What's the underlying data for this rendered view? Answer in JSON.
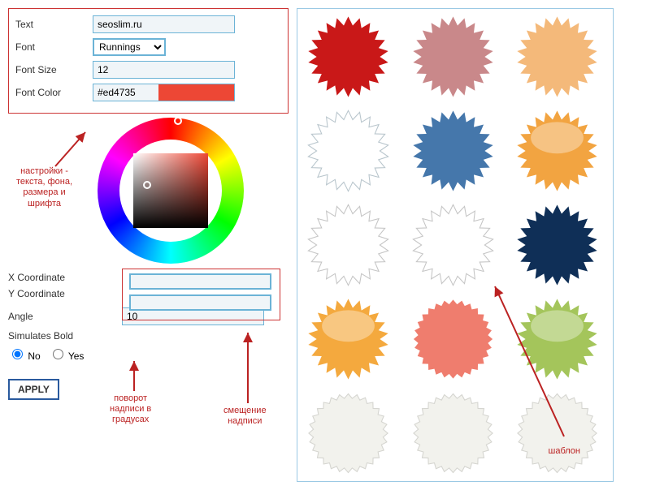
{
  "form": {
    "text_label": "Text",
    "text_value": "seoslim.ru",
    "font_label": "Font",
    "font_value": "Runnings",
    "fontsize_label": "Font Size",
    "fontsize_value": "12",
    "fontcolor_label": "Font Color",
    "fontcolor_value": "#ed4735",
    "xcoord_label": "X Coordinate",
    "xcoord_value": "",
    "ycoord_label": "Y Coordinate",
    "ycoord_value": "",
    "angle_label": "Angle",
    "angle_value": "10",
    "bold_label": "Simulates Bold",
    "radio_no": "No",
    "radio_yes": "Yes",
    "apply": "APPLY"
  },
  "annotations": {
    "settings": "настройки -\nтекста, фона,\nразмера и\nшрифта",
    "rotation": "поворот\nнадписи в\nградусах",
    "offset": "смещение\nнадписи",
    "template": "шаблон"
  },
  "badges": [
    {
      "fill": "#c91818",
      "stroke": "none",
      "type": "spike"
    },
    {
      "fill": "#c9888a",
      "stroke": "none",
      "type": "spike"
    },
    {
      "fill": "#f4b97a",
      "stroke": "none",
      "type": "spike"
    },
    {
      "fill": "#ffffff",
      "stroke": "#b8c5cc",
      "type": "spike"
    },
    {
      "fill": "#4577ab",
      "stroke": "none",
      "type": "spike"
    },
    {
      "fill": "#f2a441",
      "stroke": "none",
      "type": "spike-glossy"
    },
    {
      "fill": "#ffffff",
      "stroke": "#c5c5c5",
      "type": "spike"
    },
    {
      "fill": "#ffffff",
      "stroke": "#c5c5c5",
      "type": "spike"
    },
    {
      "fill": "#0f2f57",
      "stroke": "none",
      "type": "spike"
    },
    {
      "fill": "#f4a93e",
      "stroke": "none",
      "type": "spike-glossy"
    },
    {
      "fill": "#ef7d6e",
      "stroke": "none",
      "type": "scallop"
    },
    {
      "fill": "#a4c55b",
      "stroke": "none",
      "type": "spike-glossy"
    },
    {
      "fill": "#f2f2ed",
      "stroke": "#d5d5d0",
      "type": "scallop"
    },
    {
      "fill": "#f2f2ed",
      "stroke": "#d5d5d0",
      "type": "scallop"
    },
    {
      "fill": "#f2f2ed",
      "stroke": "#d5d5d0",
      "type": "scallop"
    }
  ]
}
